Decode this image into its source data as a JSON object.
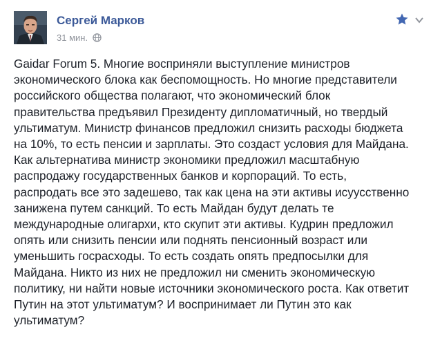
{
  "post": {
    "author": "Сергей Марков",
    "time": "31 мин.",
    "lines": [
      "Gaidar Forum 5. Многие восприняли выступление министров",
      "экономического блока как беспомощность. Но многие представители",
      "российского общества полагают, что экономический блок",
      "правительства предъявил Президенту дипломатичный, но твердый",
      "ультиматум. Министр финансов предложил снизить расходы бюджета",
      "на 10%, то есть пенсии и зарплаты. Это создаст условия для Майдана.",
      "Как альтернатива министр экономики предложил масштабную",
      "распродажу государственных банков и корпораций. То есть,",
      "распродать все это задешево, так как цена на эти активы исуусственно",
      "занижена путем санкций. То есть Майдан будут делать те",
      "международные олигархи, кто скупит эти активы. Кудрин предложил",
      "опять или снизить пенсии или поднять пенсионный возраст или",
      "уменьшить госрасходы. То есть создать опять предпосылки для",
      "Майдана. Никто из них не предложил ни сменить экономическую",
      "политику, ни найти новые источники экономического роста. Как ответит",
      "Путин на этот ультиматум? И воспринимает ли Путин это как",
      "ультиматум?"
    ]
  },
  "icons": {
    "star": "star-icon",
    "chevron": "chevron-down-icon",
    "audience": "globe-icon"
  },
  "colors": {
    "author_link": "#3b5998",
    "meta_text": "#90949c",
    "body_text": "#1d2129",
    "star": "#4267b2"
  }
}
